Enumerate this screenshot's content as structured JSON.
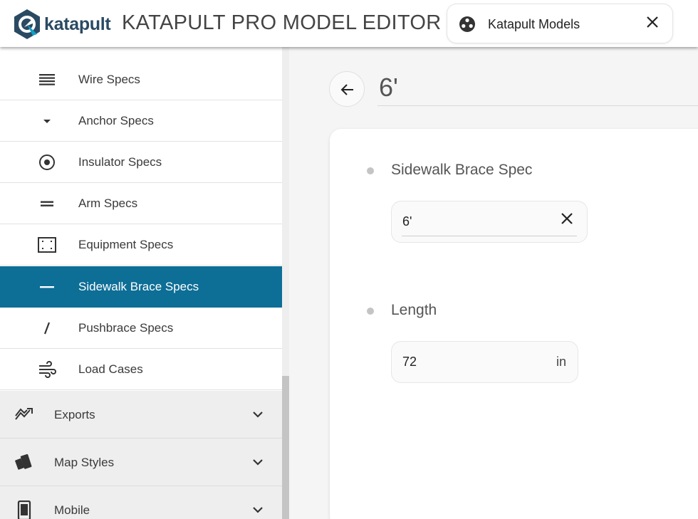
{
  "header": {
    "logo_text": "katapult",
    "app_title": "KATAPULT PRO MODEL EDITOR",
    "model_chip": {
      "label": "Katapult Models",
      "icon": "palette-icon",
      "close_icon": "close-icon"
    }
  },
  "sidebar": {
    "items": [
      {
        "label": "Wire Specs",
        "icon": "lines-icon",
        "active": false
      },
      {
        "label": "Anchor Specs",
        "icon": "caret-down-icon",
        "active": false
      },
      {
        "label": "Insulator Specs",
        "icon": "target-icon",
        "active": false
      },
      {
        "label": "Arm Specs",
        "icon": "equals-icon",
        "active": false
      },
      {
        "label": "Equipment Specs",
        "icon": "equipment-frame-icon",
        "active": false
      },
      {
        "label": "Sidewalk Brace Specs",
        "icon": "dash-icon",
        "active": true
      },
      {
        "label": "Pushbrace Specs",
        "icon": "slash-icon",
        "active": false
      },
      {
        "label": "Load Cases",
        "icon": "wind-icon",
        "active": false
      }
    ],
    "groups": [
      {
        "label": "Exports",
        "icon": "trending-icon"
      },
      {
        "label": "Map Styles",
        "icon": "style-swatch-icon"
      },
      {
        "label": "Mobile",
        "icon": "phone-icon"
      }
    ],
    "active_color": "#0d6e96"
  },
  "main": {
    "title": "6'",
    "fields": [
      {
        "label": "Sidewalk Brace Spec",
        "value": "6'",
        "has_clear": true
      },
      {
        "label": "Length",
        "value": "72",
        "unit": "in"
      }
    ]
  }
}
